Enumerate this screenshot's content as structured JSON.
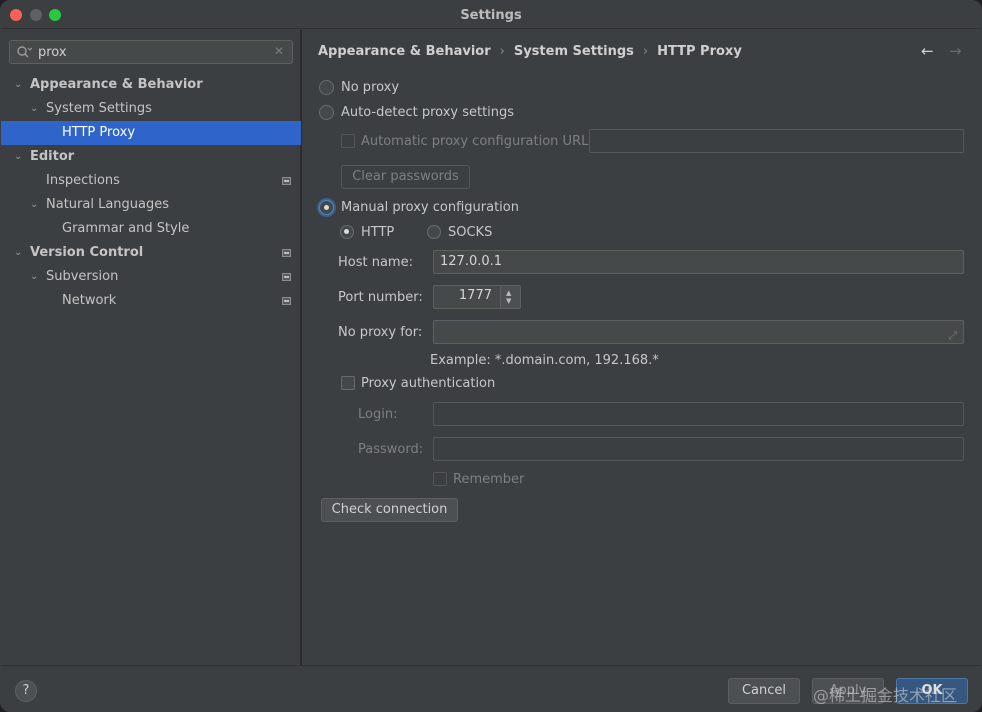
{
  "window": {
    "title": "Settings"
  },
  "search": {
    "value": "prox",
    "clear_glyph": "✕"
  },
  "tree": [
    {
      "label": "Appearance & Behavior",
      "chevron": "⌄",
      "bold": true
    },
    {
      "label": "System Settings",
      "chevron": "⌄",
      "bold": false
    },
    {
      "label": "HTTP Proxy",
      "chevron": "",
      "bold": false,
      "selected": true
    },
    {
      "label": "Editor",
      "chevron": "⌄",
      "bold": true
    },
    {
      "label": "Inspections",
      "chevron": "",
      "bold": false,
      "project_icon": true
    },
    {
      "label": "Natural Languages",
      "chevron": "⌄",
      "bold": false
    },
    {
      "label": "Grammar and Style",
      "chevron": "",
      "bold": false
    },
    {
      "label": "Version Control",
      "chevron": "⌄",
      "bold": true,
      "project_icon": true
    },
    {
      "label": "Subversion",
      "chevron": "⌄",
      "bold": false,
      "project_icon": true
    },
    {
      "label": "Network",
      "chevron": "",
      "bold": false,
      "project_icon": true
    }
  ],
  "breadcrumb": {
    "part1": "Appearance & Behavior",
    "part2": "System Settings",
    "part3": "HTTP Proxy",
    "sep": "›"
  },
  "nav": {
    "back": "←",
    "forward": "→"
  },
  "proxy": {
    "no_proxy": "No proxy",
    "auto_detect": "Auto-detect proxy settings",
    "auto_config_url_label": "Automatic proxy configuration URL:",
    "auto_config_url_value": "",
    "clear_passwords": "Clear passwords",
    "manual": "Manual proxy configuration",
    "http": "HTTP",
    "socks": "SOCKS",
    "host_label": "Host name:",
    "host_value": "127.0.0.1",
    "port_label": "Port number:",
    "port_value": "1777",
    "no_proxy_for_label": "No proxy for:",
    "no_proxy_for_value": "",
    "example": "Example: *.domain.com, 192.168.*",
    "auth": "Proxy authentication",
    "login_label": "Login:",
    "login_value": "",
    "password_label": "Password:",
    "password_value": "",
    "remember": "Remember",
    "check_connection": "Check connection"
  },
  "footer": {
    "help": "?",
    "cancel": "Cancel",
    "apply": "Apply",
    "ok": "OK",
    "watermark": "@稀土掘金技术社区"
  },
  "colors": {
    "selection": "#2f65ca",
    "accent": "#4a88c7",
    "ok_button": "#365880"
  }
}
